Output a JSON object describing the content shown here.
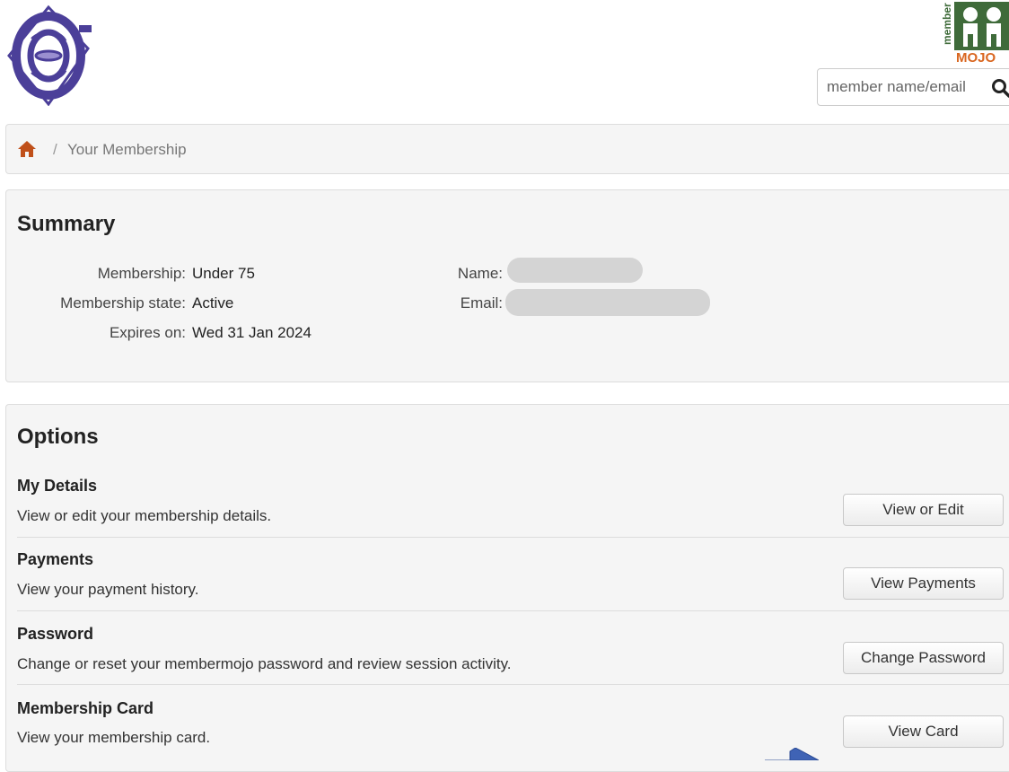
{
  "header": {
    "club_logo": "club-monogram-logo",
    "brand_logo": "membermojo-logo",
    "brand_logo_text": [
      "member",
      "MOJO"
    ]
  },
  "search": {
    "placeholder": "member name/email",
    "icon": "search-icon"
  },
  "breadcrumb": {
    "home_icon": "home-icon",
    "separator": "/",
    "current": "Your Membership"
  },
  "summary": {
    "title": "Summary",
    "fields": {
      "membership_label": "Membership:",
      "membership_value": "Under 75",
      "state_label": "Membership state:",
      "state_value": "Active",
      "expires_label": "Expires on:",
      "expires_value": "Wed 31 Jan 2024",
      "name_label": "Name:",
      "email_label": "Email:"
    }
  },
  "options": {
    "title": "Options",
    "items": [
      {
        "title": "My Details",
        "description": "View or edit your membership details.",
        "button": "View or Edit"
      },
      {
        "title": "Payments",
        "description": "View your payment history.",
        "button": "View Payments"
      },
      {
        "title": "Password",
        "description": "Change or reset your membermojo password and review session activity.",
        "button": "Change Password"
      },
      {
        "title": "Membership Card",
        "description": "View your membership card.",
        "button": "View Card"
      }
    ]
  },
  "colors": {
    "home_icon": "#c0501a",
    "logo_purple": "#4b3f99",
    "brand_green": "#3f6b3a",
    "brand_orange": "#d9661f",
    "arrow": "#3f63b5"
  }
}
